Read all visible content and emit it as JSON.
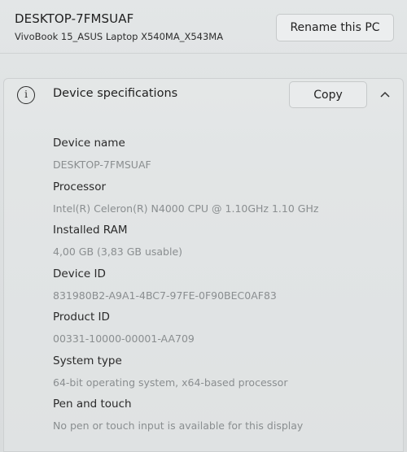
{
  "pc": {
    "name": "DESKTOP-7FMSUAF",
    "model": "VivoBook 15_ASUS Laptop X540MA_X543MA",
    "rename_label": "Rename this PC"
  },
  "specs": {
    "title": "Device specifications",
    "info_icon": "info-icon",
    "copy_label": "Copy",
    "collapse_icon": "chevron-up-icon",
    "items": [
      {
        "label": "Device name",
        "value": "DESKTOP-7FMSUAF"
      },
      {
        "label": "Processor",
        "value": "Intel(R) Celeron(R) N4000 CPU @ 1.10GHz   1.10 GHz"
      },
      {
        "label": "Installed RAM",
        "value": "4,00 GB (3,83 GB usable)"
      },
      {
        "label": "Device ID",
        "value": "831980B2-A9A1-4BC7-97FE-0F90BEC0AF83"
      },
      {
        "label": "Product ID",
        "value": "00331-10000-00001-AA709"
      },
      {
        "label": "System type",
        "value": "64-bit operating system, x64-based processor"
      },
      {
        "label": "Pen and touch",
        "value": "No pen or touch input is available for this display"
      }
    ]
  }
}
